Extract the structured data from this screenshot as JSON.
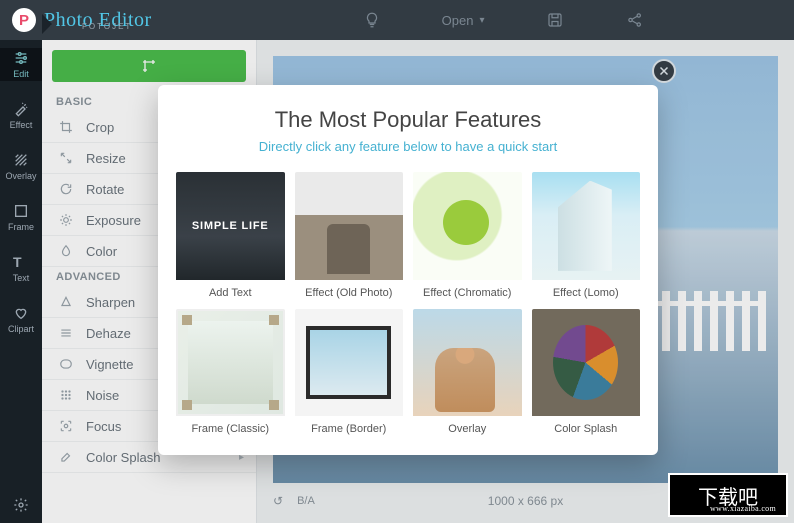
{
  "header": {
    "logo_title": "Photo Editor",
    "logo_sub": "FOTOJET",
    "open_label": "Open"
  },
  "rail": [
    {
      "icon": "sliders",
      "label": "Edit",
      "active": true
    },
    {
      "icon": "wand",
      "label": "Effect"
    },
    {
      "icon": "hatch",
      "label": "Overlay"
    },
    {
      "icon": "square",
      "label": "Frame"
    },
    {
      "icon": "text",
      "label": "Text"
    },
    {
      "icon": "heart",
      "label": "Clipart"
    }
  ],
  "panel": {
    "basic_label": "BASIC",
    "advanced_label": "ADVANCED",
    "basic": [
      {
        "name": "Crop",
        "icon": "crop"
      },
      {
        "name": "Resize",
        "icon": "resize"
      },
      {
        "name": "Rotate",
        "icon": "rotate"
      },
      {
        "name": "Exposure",
        "icon": "sun"
      },
      {
        "name": "Color",
        "icon": "drop"
      }
    ],
    "advanced": [
      {
        "name": "Sharpen",
        "icon": "triangle"
      },
      {
        "name": "Dehaze",
        "icon": "lines"
      },
      {
        "name": "Vignette",
        "icon": "vignette"
      },
      {
        "name": "Noise",
        "icon": "grid"
      },
      {
        "name": "Focus",
        "icon": "focus",
        "expandable": true
      },
      {
        "name": "Color Splash",
        "icon": "brush",
        "expandable": true
      }
    ]
  },
  "canvas": {
    "dimensions": "1000 x 666 px"
  },
  "modal": {
    "title": "The Most Popular Features",
    "subtitle": "Directly click any feature below to have a quick start",
    "simple_text": "SIMPLE LIFE",
    "items": [
      {
        "label": "Add Text"
      },
      {
        "label": "Effect (Old Photo)"
      },
      {
        "label": "Effect (Chromatic)"
      },
      {
        "label": "Effect (Lomo)"
      },
      {
        "label": "Frame (Classic)"
      },
      {
        "label": "Frame (Border)"
      },
      {
        "label": "Overlay"
      },
      {
        "label": "Color Splash"
      }
    ]
  },
  "ext": {
    "text": "下载吧",
    "url": "www.xiazaiba.com"
  }
}
